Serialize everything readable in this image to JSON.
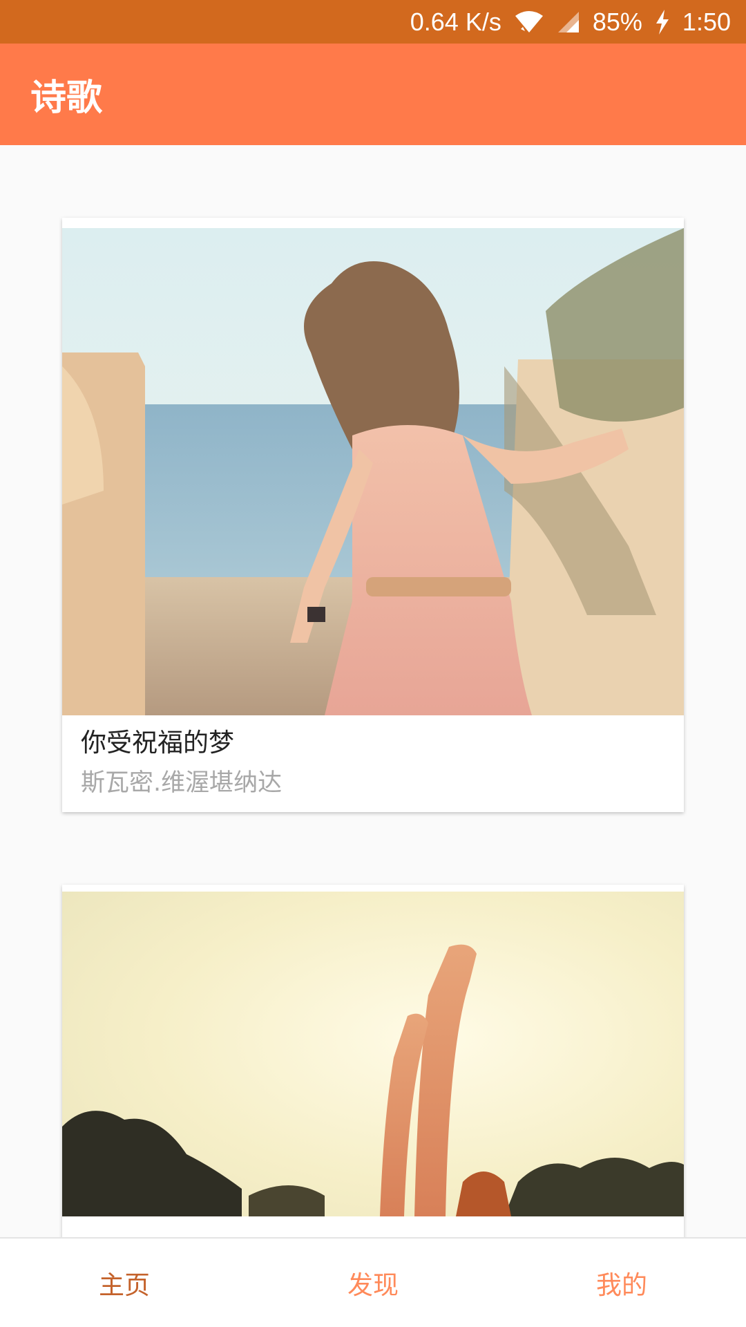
{
  "status_bar": {
    "net_speed": "0.64 K/s",
    "battery": "85%",
    "time": "1:50",
    "icons": [
      "wifi-icon",
      "signal-icon",
      "charging-icon"
    ]
  },
  "app_bar": {
    "title": "诗歌"
  },
  "poems": [
    {
      "title": "你受祝福的梦",
      "author": "斯瓦密.维渥堪纳达",
      "image": "girl-on-beach-photo"
    },
    {
      "image": "arms-raised-sunset-photo"
    }
  ],
  "bottom_nav": {
    "items": [
      {
        "label": "主页"
      },
      {
        "label": "发现"
      },
      {
        "label": "我的"
      }
    ],
    "active": "主页"
  },
  "colors": {
    "status_bar": "#d2691e",
    "app_bar": "#ff7a4a",
    "nav_active": "#c4622b",
    "nav_inactive": "#ff8a5a"
  }
}
